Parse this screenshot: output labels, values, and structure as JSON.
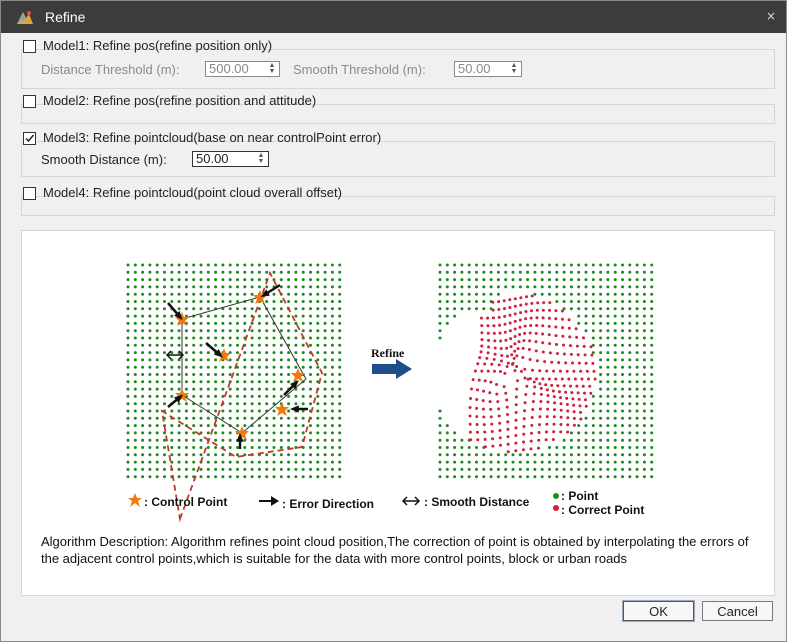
{
  "window": {
    "title": "Refine",
    "close_glyph": "×"
  },
  "model1": {
    "label": "Model1: Refine pos(refine position only)",
    "checked": false,
    "distance_label": "Distance Threshold (m):",
    "distance_value": "500.00",
    "smooth_label": "Smooth Threshold (m):",
    "smooth_value": "50.00"
  },
  "model2": {
    "label": "Model2: Refine pos(refine position and attitude)",
    "checked": false
  },
  "model3": {
    "label": "Model3: Refine pointcloud(base on near controlPoint error)",
    "checked": true,
    "smooth_distance_label": "Smooth Distance (m):",
    "smooth_distance_value": "50.00"
  },
  "model4": {
    "label": "Model4: Refine pointcloud(point cloud overall offset)",
    "checked": false
  },
  "illustration": {
    "refine_label": "Refine",
    "legend": {
      "control_point": ": Control Point",
      "error_direction": ": Error Direction",
      "smooth_distance": ": Smooth Distance",
      "point": ": Point",
      "correct_point": ": Correct  Point"
    },
    "colors": {
      "point": "#1e8a1e",
      "correct_point": "#d0203a",
      "control_point": "#f07a10",
      "boundary": "#c0392b",
      "arrow": "#1f4e8c"
    }
  },
  "description": "Algorithm Description: Algorithm refines point cloud position,The correction of point is obtained by interpolating the errors of the adjacent control points,which is suitable for the data with more control points, block or urban roads",
  "buttons": {
    "ok": "OK",
    "cancel": "Cancel"
  }
}
